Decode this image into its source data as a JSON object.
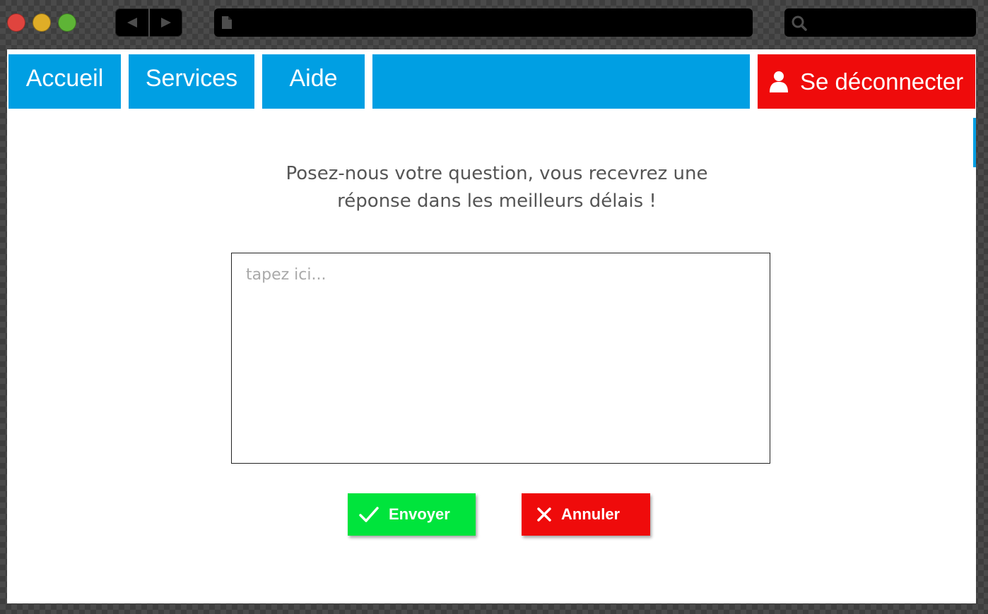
{
  "window": {
    "traffic_lights": {
      "close": "#e0443e",
      "minimize": "#dfad27",
      "maximize": "#5eb436"
    },
    "icons": {
      "back": "back-arrow-icon",
      "forward": "forward-arrow-icon",
      "page": "page-icon",
      "search": "search-icon"
    }
  },
  "nav": {
    "tabs": [
      {
        "label": "Accueil"
      },
      {
        "label": "Services"
      },
      {
        "label": "Aide"
      }
    ],
    "logout_label": "Se déconnecter",
    "accent_color": "#009fe3",
    "logout_color": "#ef0b0b"
  },
  "main": {
    "prompt_line1": "Posez-nous votre question, vous recevrez une",
    "prompt_line2": "réponse dans les meilleurs délais !",
    "question_field": {
      "value": "",
      "placeholder": "tapez ici..."
    }
  },
  "actions": {
    "send_label": "Envoyer",
    "send_color": "#00e43c",
    "cancel_label": "Annuler",
    "cancel_color": "#ef0b0b"
  }
}
